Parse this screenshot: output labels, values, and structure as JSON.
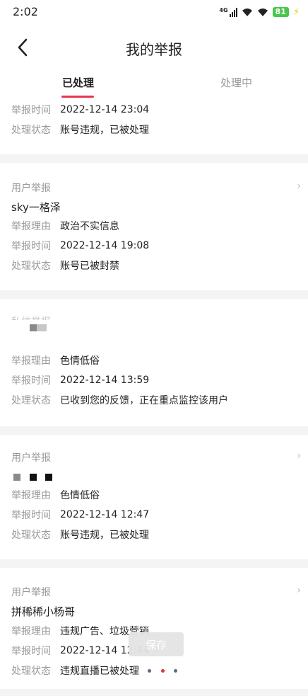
{
  "status_bar": {
    "time": "2:02",
    "network": "4G",
    "battery": "81",
    "icons": [
      "signal-icon",
      "wifi-icon",
      "wifi-icon",
      "battery-icon",
      "charging-icon"
    ]
  },
  "header": {
    "title": "我的举报",
    "back_icon": "chevron-left-icon"
  },
  "tabs": [
    {
      "label": "已处理",
      "active": true
    },
    {
      "label": "处理中",
      "active": false
    }
  ],
  "labels": {
    "reason": "举报理由",
    "time": "举报时间",
    "status": "处理状态"
  },
  "reports": [
    {
      "time": "2022-12-14 23:04",
      "status": "账号违规，已被处理"
    },
    {
      "type": "用户举报",
      "user": "sky一格泽",
      "reason": "政治不实信息",
      "time": "2022-12-14 19:08",
      "status": "账号已被封禁"
    },
    {
      "type": "私信举报",
      "reason": "色情低俗",
      "time": "2022-12-14 13:59",
      "status": "已收到您的反馈，正在重点监控该用户"
    },
    {
      "type": "用户举报",
      "reason": "色情低俗",
      "time": "2022-12-14 12:47",
      "status": "账号违规，已被处理"
    },
    {
      "type": "用户举报",
      "user": "拼稀稀小杨哥",
      "reason": "违规广告、垃圾营销",
      "time": "2022-12-14 12:44",
      "status": "违规直播已被处理"
    }
  ],
  "overlay": {
    "save_label": "保存"
  },
  "colors": {
    "accent": "#e8344d",
    "label": "#999999",
    "text": "#222222",
    "separator": "#f4f4f4",
    "battery": "#49c74a"
  }
}
